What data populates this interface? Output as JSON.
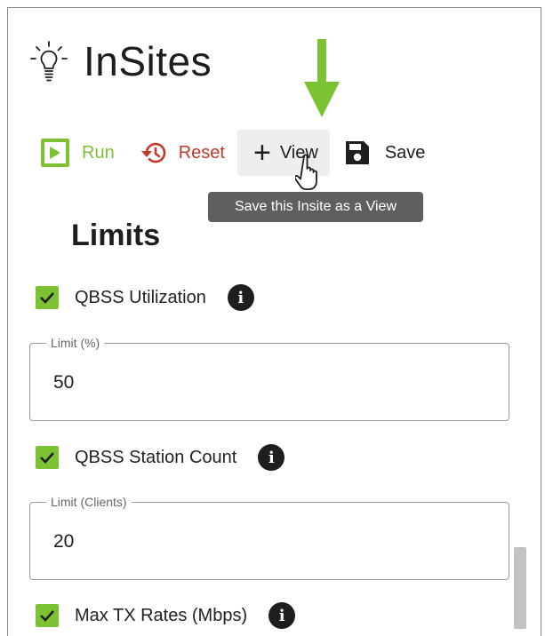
{
  "app": {
    "title": "InSites",
    "icon": "lightbulb-icon"
  },
  "toolbar": {
    "run_label": "Run",
    "reset_label": "Reset",
    "view_label": "View",
    "save_label": "Save"
  },
  "tooltip": {
    "text": "Save this Insite as a View"
  },
  "limits": {
    "title": "Limits",
    "items": [
      {
        "label": "QBSS Utilization",
        "checked": true,
        "field_label": "Limit (%)",
        "value": "50"
      },
      {
        "label": "QBSS Station Count",
        "checked": true,
        "field_label": "Limit (Clients)",
        "value": "20"
      },
      {
        "label": "Max TX Rates (Mbps)",
        "checked": true
      }
    ]
  },
  "colors": {
    "accent_green": "#7cc334",
    "reset_red": "#c0392b",
    "tooltip_bg": "#5f5f5f"
  }
}
